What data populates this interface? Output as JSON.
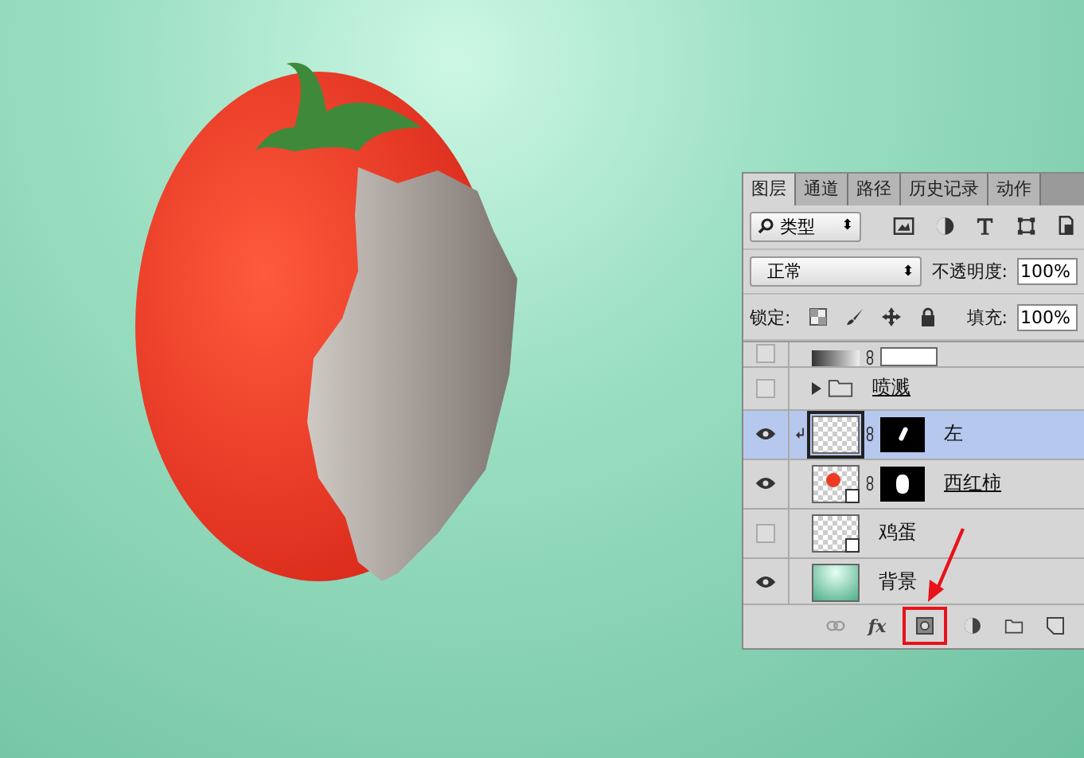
{
  "layers_panel": {
    "tabs": [
      {
        "label": "图层",
        "selected": true
      },
      {
        "label": "通道",
        "selected": false
      },
      {
        "label": "路径",
        "selected": false
      },
      {
        "label": "历史记录",
        "selected": false
      },
      {
        "label": "动作",
        "selected": false
      }
    ],
    "filter": {
      "value": "类型",
      "arrows": "⬍"
    },
    "blend_mode": {
      "value": "正常",
      "arrows": "⬍"
    },
    "opacity_label": "不透明度:",
    "opacity": "100%",
    "lock_label": "锁定:",
    "fill_label": "填充:",
    "fill": "100%",
    "layers": [
      {
        "kind": "adjustment",
        "visible": false,
        "selected": false
      },
      {
        "kind": "group",
        "name": "喷溅",
        "visible": false,
        "selected": false
      },
      {
        "kind": "clipped",
        "name": "左",
        "visible": true,
        "selected": true
      },
      {
        "kind": "masked",
        "name": "西红柿",
        "visible": true,
        "selected": false
      },
      {
        "kind": "smart",
        "name": "鸡蛋",
        "visible": false,
        "selected": false
      },
      {
        "kind": "background",
        "name": "背景",
        "visible": true,
        "selected": false
      }
    ],
    "footer_buttons": [
      {
        "kind": "link",
        "highlighted": false
      },
      {
        "kind": "fx",
        "label": "fx",
        "highlighted": false
      },
      {
        "kind": "mask",
        "highlighted": true
      },
      {
        "kind": "adjustment",
        "highlighted": false
      },
      {
        "kind": "group",
        "highlighted": false
      },
      {
        "kind": "new",
        "highlighted": false
      }
    ]
  }
}
